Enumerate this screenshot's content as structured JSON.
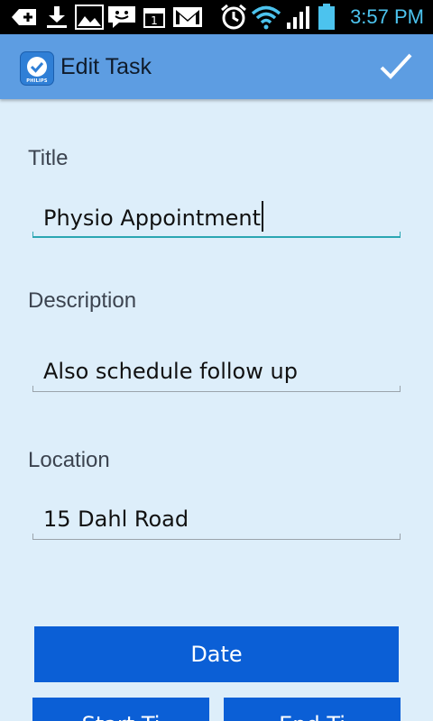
{
  "status_bar": {
    "time": "3:57 PM",
    "icons": [
      "add-icon",
      "download-icon",
      "image-icon",
      "chat-icon",
      "calendar-icon",
      "gmail-icon",
      "alarm-icon",
      "wifi-icon",
      "signal-icon",
      "battery-icon"
    ],
    "calendar_day": "1"
  },
  "action_bar": {
    "title": "Edit Task",
    "logo_text": "PHILIPS",
    "confirm_icon": "check-icon",
    "background": "#5d9de2"
  },
  "form": {
    "title_label": "Title",
    "title_value": "Physio Appointment",
    "description_label": "Description",
    "description_value": "Also schedule follow up",
    "location_label": "Location",
    "location_value": "15 Dahl Road"
  },
  "buttons": {
    "date": "Date",
    "start_time": "Start Ti",
    "end_time": "End Ti",
    "color": "#0b5fd6"
  }
}
